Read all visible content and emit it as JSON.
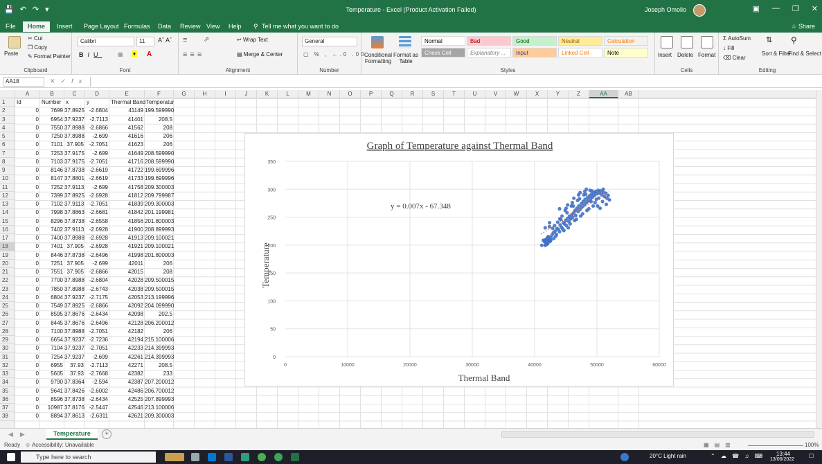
{
  "window": {
    "title": "Temperature  -  Excel (Product Activation Failed)",
    "user": "Joseph Omollo"
  },
  "ribbon_tabs": [
    "File",
    "Home",
    "Insert",
    "Page Layout",
    "Formulas",
    "Data",
    "Review",
    "View",
    "Help"
  ],
  "tell_me": "Tell me what you want to do",
  "share_label": "Share",
  "ribbon": {
    "clipboard": {
      "paste": "Paste",
      "cut": "Cut",
      "copy": "Copy",
      "format_painter": "Format Painter",
      "label": "Clipboard"
    },
    "font": {
      "name": "Calibri",
      "size": "11",
      "label": "Font"
    },
    "alignment": {
      "wrap": "Wrap Text",
      "merge": "Merge & Center",
      "label": "Alignment"
    },
    "number": {
      "format": "General",
      "label": "Number"
    },
    "styles": {
      "conditional": "Conditional Formatting",
      "format_table": "Format as Table",
      "cells": [
        {
          "text": "Normal",
          "bg": "#ffffff",
          "fg": "#000000"
        },
        {
          "text": "Bad",
          "bg": "#ffc7ce",
          "fg": "#9c0006"
        },
        {
          "text": "Good",
          "bg": "#c6efce",
          "fg": "#006100"
        },
        {
          "text": "Neutral",
          "bg": "#ffeb9c",
          "fg": "#9c5700"
        },
        {
          "text": "Calculation",
          "bg": "#f2f2f2",
          "fg": "#fa7d00"
        },
        {
          "text": "Check Cell",
          "bg": "#a5a5a5",
          "fg": "#ffffff"
        },
        {
          "text": "Explanatory ...",
          "bg": "#ffffff",
          "fg": "#7f7f7f"
        },
        {
          "text": "Input",
          "bg": "#ffcc99",
          "fg": "#3f3f76"
        },
        {
          "text": "Linked Cell",
          "bg": "#ffffff",
          "fg": "#fa7d00"
        },
        {
          "text": "Note",
          "bg": "#ffffcc",
          "fg": "#000000"
        }
      ],
      "label": "Styles"
    },
    "cells": {
      "insert": "Insert",
      "delete": "Delete",
      "format": "Format",
      "label": "Cells"
    },
    "editing": {
      "autosum": "AutoSum",
      "fill": "Fill",
      "clear": "Clear",
      "sort": "Sort & Filter",
      "find": "Find & Select",
      "label": "Editing"
    }
  },
  "formula_bar": {
    "name_box": "AA18",
    "fx": "fx",
    "value": ""
  },
  "columns": [
    "A",
    "B",
    "C",
    "D",
    "E",
    "F",
    "G",
    "H",
    "I",
    "J",
    "K",
    "L",
    "M",
    "N",
    "O",
    "P",
    "Q",
    "R",
    "S",
    "T",
    "U",
    "V",
    "W",
    "X",
    "Y",
    "Z",
    "AA",
    "AB"
  ],
  "selected_column": "AA",
  "selected_row": 18,
  "headers": [
    "Id",
    "Number",
    "x",
    "y",
    "Thermal Band",
    "Temperature"
  ],
  "rows": [
    [
      "0",
      "7699",
      "37.8925",
      "-2.6804",
      "41149",
      "199.5999908"
    ],
    [
      "0",
      "6954",
      "37.9237",
      "-2.7113",
      "41401",
      "208.5"
    ],
    [
      "0",
      "7550",
      "37.8988",
      "-2.6866",
      "41562",
      "208"
    ],
    [
      "0",
      "7250",
      "37.8988",
      "-2.699",
      "41616",
      "206"
    ],
    [
      "0",
      "7101",
      "37.905",
      "-2.7051",
      "41623",
      "206"
    ],
    [
      "0",
      "7253",
      "37.9175",
      "-2.699",
      "41649",
      "208.5999908"
    ],
    [
      "0",
      "7103",
      "37.9175",
      "-2.7051",
      "41716",
      "208.5999908"
    ],
    [
      "0",
      "8146",
      "37.8738",
      "-2.6619",
      "41722",
      "199.6999969"
    ],
    [
      "0",
      "8147",
      "37.8801",
      "-2.6619",
      "41733",
      "199.6999969"
    ],
    [
      "0",
      "7252",
      "37.9113",
      "-2.699",
      "41758",
      "209.3000031"
    ],
    [
      "0",
      "7399",
      "37.8925",
      "-2.6928",
      "41812",
      "209.7999878"
    ],
    [
      "0",
      "7102",
      "37.9113",
      "-2.7051",
      "41839",
      "209.3000031"
    ],
    [
      "0",
      "7998",
      "37.8863",
      "-2.6681",
      "41842",
      "201.1999817"
    ],
    [
      "0",
      "8296",
      "37.8738",
      "-2.6558",
      "41856",
      "201.8000031"
    ],
    [
      "0",
      "7402",
      "37.9113",
      "-2.6928",
      "41900",
      "208.8999939"
    ],
    [
      "0",
      "7400",
      "37.8988",
      "-2.6928",
      "41913",
      "209.1000214"
    ],
    [
      "0",
      "7401",
      "37.905",
      "-2.6928",
      "41921",
      "209.1000214"
    ],
    [
      "0",
      "8446",
      "37.8738",
      "-2.6496",
      "41998",
      "201.8000031"
    ],
    [
      "0",
      "7251",
      "37.905",
      "-2.699",
      "42011",
      "206"
    ],
    [
      "0",
      "7551",
      "37.905",
      "-2.6866",
      "42015",
      "208"
    ],
    [
      "0",
      "7700",
      "37.8988",
      "-2.6804",
      "42028",
      "209.5000153"
    ],
    [
      "0",
      "7850",
      "37.8988",
      "-2.6743",
      "42038",
      "209.5000153"
    ],
    [
      "0",
      "6804",
      "37.9237",
      "-2.7175",
      "42053",
      "213.1999969"
    ],
    [
      "0",
      "7549",
      "37.8925",
      "-2.6866",
      "42092",
      "204.0999908"
    ],
    [
      "0",
      "8595",
      "37.8676",
      "-2.6434",
      "42098",
      "202.5"
    ],
    [
      "0",
      "8445",
      "37.8676",
      "-2.6496",
      "42128",
      "206.2000122"
    ],
    [
      "0",
      "7100",
      "37.8988",
      "-2.7051",
      "42182",
      "206"
    ],
    [
      "0",
      "6654",
      "37.9237",
      "-2.7236",
      "42194",
      "215.1000061"
    ],
    [
      "0",
      "7104",
      "37.9237",
      "-2.7051",
      "42233",
      "214.3999939"
    ],
    [
      "0",
      "7254",
      "37.9237",
      "-2.699",
      "42261",
      "214.3999939"
    ],
    [
      "0",
      "6955",
      "37.93",
      "-2.7113",
      "42271",
      "208.5"
    ],
    [
      "0",
      "5605",
      "37.93",
      "-2.7668",
      "42382",
      "233"
    ],
    [
      "0",
      "9790",
      "37.8364",
      "-2.594",
      "42387",
      "207.2000122"
    ],
    [
      "0",
      "9641",
      "37.8426",
      "-2.6002",
      "42486",
      "206.7000122"
    ],
    [
      "0",
      "8596",
      "37.8738",
      "-2.6434",
      "42525",
      "207.8999939"
    ],
    [
      "0",
      "10987",
      "37.8176",
      "-2.5447",
      "42546",
      "213.1000061"
    ],
    [
      "0",
      "8894",
      "37.8613",
      "-2.6311",
      "42621",
      "209.3000031"
    ]
  ],
  "chart_data": {
    "type": "scatter",
    "title": "Graph of Temperature against Thermal Band",
    "xlabel": "Thermal Band",
    "ylabel": "Temperature",
    "xlim": [
      0,
      60000
    ],
    "ylim": [
      0,
      350
    ],
    "xticks": [
      0,
      10000,
      20000,
      30000,
      40000,
      50000,
      60000
    ],
    "yticks": [
      0,
      50,
      100,
      150,
      200,
      250,
      300,
      350
    ],
    "grid": true,
    "trendline": {
      "equation": "y = 0.007x - 67.348",
      "slope": 0.007,
      "intercept": -67.348,
      "x_range": [
        41000,
        52000
      ]
    },
    "series": [
      {
        "color": "#4472c4",
        "points": [
          [
            41149,
            199.6
          ],
          [
            41401,
            208.5
          ],
          [
            41562,
            208
          ],
          [
            41616,
            206
          ],
          [
            41623,
            206
          ],
          [
            41649,
            208.6
          ],
          [
            41716,
            208.6
          ],
          [
            41722,
            199.7
          ],
          [
            41733,
            199.7
          ],
          [
            41758,
            209.3
          ],
          [
            41812,
            209.8
          ],
          [
            41839,
            209.3
          ],
          [
            41842,
            201.2
          ],
          [
            41856,
            201.8
          ],
          [
            41900,
            208.9
          ],
          [
            41913,
            209.1
          ],
          [
            41921,
            209.1
          ],
          [
            41998,
            201.8
          ],
          [
            42011,
            206
          ],
          [
            42015,
            208
          ],
          [
            42028,
            209.5
          ],
          [
            42038,
            209.5
          ],
          [
            42053,
            213.2
          ],
          [
            42092,
            204.1
          ],
          [
            42098,
            202.5
          ],
          [
            42128,
            206.2
          ],
          [
            42182,
            206
          ],
          [
            42194,
            215.1
          ],
          [
            42233,
            214.4
          ],
          [
            42261,
            214.4
          ],
          [
            42271,
            208.5
          ],
          [
            42382,
            233
          ],
          [
            42387,
            207.2
          ],
          [
            42486,
            206.7
          ],
          [
            42525,
            207.9
          ],
          [
            42546,
            213.1
          ],
          [
            42621,
            209.3
          ],
          [
            42800,
            218
          ],
          [
            43000,
            222
          ],
          [
            43100,
            212
          ],
          [
            43300,
            225
          ],
          [
            43500,
            219
          ],
          [
            43600,
            230
          ],
          [
            43800,
            228
          ],
          [
            44000,
            224
          ],
          [
            44100,
            236
          ],
          [
            44300,
            232
          ],
          [
            44500,
            229
          ],
          [
            44600,
            240
          ],
          [
            44800,
            238
          ],
          [
            45000,
            244
          ],
          [
            45100,
            235
          ],
          [
            45300,
            248
          ],
          [
            45500,
            242
          ],
          [
            45600,
            252
          ],
          [
            45800,
            247
          ],
          [
            46000,
            255
          ],
          [
            46100,
            250
          ],
          [
            46300,
            258
          ],
          [
            46500,
            262
          ],
          [
            46600,
            253
          ],
          [
            46800,
            266
          ],
          [
            47000,
            260
          ],
          [
            47100,
            270
          ],
          [
            47300,
            264
          ],
          [
            47500,
            274
          ],
          [
            47600,
            268
          ],
          [
            47800,
            278
          ],
          [
            48000,
            272
          ],
          [
            48100,
            282
          ],
          [
            48300,
            276
          ],
          [
            48500,
            285
          ],
          [
            48600,
            279
          ],
          [
            48800,
            288
          ],
          [
            49000,
            283
          ],
          [
            49100,
            291
          ],
          [
            49300,
            286
          ],
          [
            49500,
            294
          ],
          [
            49600,
            289
          ],
          [
            49800,
            296
          ],
          [
            50000,
            292
          ],
          [
            50200,
            298
          ],
          [
            50400,
            293
          ],
          [
            50600,
            297
          ],
          [
            50800,
            290
          ],
          [
            51000,
            295
          ],
          [
            51200,
            287
          ],
          [
            51400,
            293
          ],
          [
            51600,
            284
          ],
          [
            51800,
            289
          ],
          [
            52000,
            281
          ],
          [
            44200,
            246
          ],
          [
            44700,
            226
          ],
          [
            45200,
            258
          ],
          [
            45700,
            238
          ],
          [
            46200,
            270
          ],
          [
            46700,
            246
          ],
          [
            47200,
            283
          ],
          [
            47700,
            256
          ],
          [
            48200,
            291
          ],
          [
            48700,
            265
          ],
          [
            49200,
            297
          ],
          [
            49700,
            276
          ],
          [
            50300,
            284
          ],
          [
            50900,
            278
          ],
          [
            51500,
            273
          ],
          [
            43700,
            241
          ],
          [
            44400,
            252
          ],
          [
            45400,
            231
          ],
          [
            46400,
            244
          ],
          [
            47400,
            252
          ],
          [
            48400,
            262
          ],
          [
            49400,
            270
          ],
          [
            50500,
            266
          ],
          [
            42900,
            230
          ],
          [
            43400,
            216
          ],
          [
            44900,
            262
          ],
          [
            45900,
            270
          ],
          [
            46900,
            280
          ],
          [
            47900,
            290
          ],
          [
            48900,
            298
          ],
          [
            49900,
            282
          ],
          [
            43200,
            235
          ],
          [
            44050,
            247
          ],
          [
            45050,
            266
          ],
          [
            46050,
            276
          ],
          [
            47050,
            290
          ],
          [
            48050,
            296
          ],
          [
            49050,
            278
          ],
          [
            50100,
            270
          ],
          [
            45300,
            272
          ],
          [
            46300,
            284
          ],
          [
            47300,
            294
          ],
          [
            48300,
            300
          ],
          [
            41700,
            231
          ],
          [
            42400,
            240
          ],
          [
            44000,
            265
          ],
          [
            51000,
            300
          ]
        ]
      }
    ]
  },
  "sheet_tab": "Temperature",
  "status": {
    "ready": "Ready",
    "accessibility": "Accessibility: Unavailable",
    "zoom": "100%"
  },
  "taskbar": {
    "search_placeholder": "Type here to search",
    "weather": "20°C  Light rain",
    "time": "13:44",
    "date": "13/06/2022"
  }
}
